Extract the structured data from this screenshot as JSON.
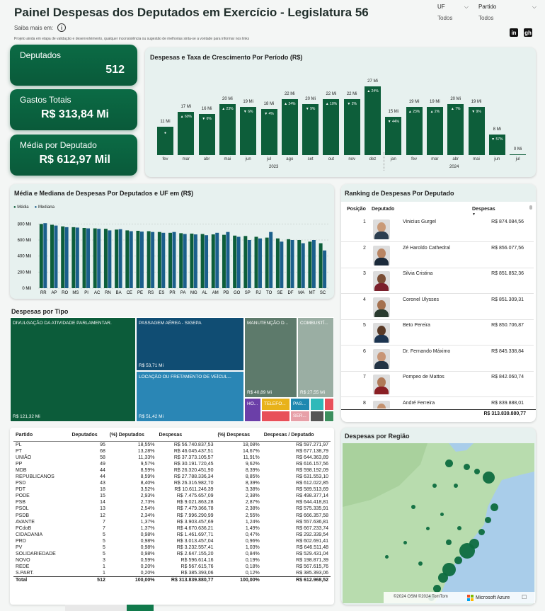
{
  "header": {
    "title": "Painel Despesas dos Deputados em Exercício - Legislatura 56",
    "saiba_mais": "Saiba mais em:",
    "info_icon": "i",
    "disclaimer": "Projeto ainda em etapa de validação e desenvolvimento, qualquer inconsistência ou sugestão de melhorias sinta-se a vontade para informar nos links",
    "filters": [
      {
        "label": "UF",
        "value": "Todos"
      },
      {
        "label": "Partido",
        "value": "Todos"
      }
    ],
    "social": [
      "in",
      "gh"
    ]
  },
  "kpis": [
    {
      "label": "Deputados",
      "value": "512"
    },
    {
      "label": "Gastos Totais",
      "value": "R$ 313,84 Mi"
    },
    {
      "label": "Média por Deputado",
      "value": "R$ 612,97 Mil"
    }
  ],
  "period_chart": {
    "title": "Despesas e Taxa de Crescimento Por Período (R$)",
    "bars": [
      {
        "month": "fev",
        "label": "11 Mi",
        "value": 11,
        "growth": ""
      },
      {
        "month": "mar",
        "label": "17 Mi",
        "value": 17,
        "growth": "▲ 60%"
      },
      {
        "month": "abr",
        "label": "16 Mi",
        "value": 16,
        "growth": "▼ 6%"
      },
      {
        "month": "mai",
        "label": "20 Mi",
        "value": 20,
        "growth": "▲ 23%"
      },
      {
        "month": "jun",
        "label": "19 Mi",
        "value": 19,
        "growth": "▼ 6%"
      },
      {
        "month": "jul",
        "label": "18 Mi",
        "value": 18,
        "growth": "▼ 4%"
      },
      {
        "month": "ago",
        "label": "22 Mi",
        "value": 22,
        "growth": "▲ 24%"
      },
      {
        "month": "set",
        "label": "20 Mi",
        "value": 20,
        "growth": "▼ 9%"
      },
      {
        "month": "out",
        "label": "22 Mi",
        "value": 22,
        "growth": "▲ 10%"
      },
      {
        "month": "nov",
        "label": "22 Mi",
        "value": 22,
        "growth": "▼ 2%"
      },
      {
        "month": "dez",
        "label": "27 Mi",
        "value": 27,
        "growth": "▲ 24%"
      },
      {
        "month": "jan",
        "label": "15 Mi",
        "value": 15,
        "growth": "▼ 44%"
      },
      {
        "month": "fev",
        "label": "19 Mi",
        "value": 19,
        "growth": "▲ 23%"
      },
      {
        "month": "mar",
        "label": "19 Mi",
        "value": 19,
        "growth": "▲ 2%"
      },
      {
        "month": "abr",
        "label": "20 Mi",
        "value": 20,
        "growth": "▲ 7%"
      },
      {
        "month": "mai",
        "label": "19 Mi",
        "value": 19,
        "growth": "▼ 9%"
      },
      {
        "month": "jun",
        "label": "8 Mi",
        "value": 8,
        "growth": "▼ 57%"
      },
      {
        "month": "jul",
        "label": "0 Mi",
        "value": 0.3,
        "growth": ""
      }
    ],
    "years": [
      "2023",
      "2024"
    ],
    "first_bar_marker": "●"
  },
  "chart_data": {
    "type": "bar",
    "title": "Média e Mediana de Despesas Por Deputados e UF em (R$)",
    "categories": [
      "RR",
      "AP",
      "RO",
      "MS",
      "PI",
      "AC",
      "RN",
      "BA",
      "CE",
      "PE",
      "RS",
      "ES",
      "PR",
      "PA",
      "MG",
      "AL",
      "AM",
      "PB",
      "GO",
      "SP",
      "RJ",
      "TO",
      "SE",
      "DF",
      "MA",
      "MT",
      "SC"
    ],
    "series": [
      {
        "name": "Média",
        "values": [
          800,
          790,
          770,
          760,
          750,
          745,
          740,
          730,
          720,
          715,
          710,
          700,
          690,
          685,
          680,
          675,
          670,
          665,
          655,
          650,
          640,
          630,
          620,
          610,
          600,
          580,
          560
        ]
      },
      {
        "name": "Mediana",
        "values": [
          810,
          780,
          760,
          755,
          745,
          740,
          720,
          735,
          710,
          705,
          700,
          690,
          700,
          675,
          670,
          660,
          690,
          700,
          640,
          600,
          620,
          700,
          580,
          600,
          560,
          600,
          470
        ]
      }
    ],
    "yticks": [
      "0 Mil",
      "200 Mil",
      "400 Mil",
      "600 Mil",
      "800 Mil"
    ],
    "ylim": [
      0,
      900
    ],
    "legend": "top-left"
  },
  "treemap": {
    "title": "Despesas por Tipo",
    "cells": [
      {
        "label": "DIVULGAÇÃO DA ATIVIDADE PARLAMENTAR.",
        "value": "R$ 121,32 Mi",
        "color": "#0c5c3a"
      },
      {
        "label": "PASSAGEM AÉREA - SIGEPA",
        "value": "R$ 53,71 Mi",
        "color": "#104d73"
      },
      {
        "label": "LOCAÇÃO OU FRETAMENTO DE VEÍCUL...",
        "value": "R$ 51,42 Mi",
        "color": "#2a86b5"
      },
      {
        "label": "MANUTENÇÃO D...",
        "value": "R$ 40,89 Mi",
        "color": "#5d7a6b"
      },
      {
        "label": "COMBUSTÍ...",
        "value": "R$ 27,55 Mi",
        "color": "#9aaea3"
      },
      {
        "label": "HO...",
        "value": "",
        "color": "#6b3fa8"
      },
      {
        "label": "TELEFO...",
        "value": "",
        "color": "#e8b21a"
      },
      {
        "label": "PAS...",
        "value": "",
        "color": "#1f88b0"
      },
      {
        "label": "",
        "value": "",
        "color": "#2fb9b9"
      },
      {
        "label": "",
        "value": "",
        "color": "#e8505a"
      },
      {
        "label": "SER...",
        "value": "",
        "color": "#e7a0a8"
      },
      {
        "label": "",
        "value": "",
        "color": "#555"
      },
      {
        "label": "",
        "value": "",
        "color": "#3c8f5e"
      }
    ]
  },
  "ranking": {
    "title": "Ranking de Despesas Por Deputado",
    "headers": [
      "Posição",
      "Deputado",
      "Despesas"
    ],
    "rows": [
      {
        "pos": "1",
        "name": "Vinicius Gurgel",
        "value": "R$ 874.084,56"
      },
      {
        "pos": "2",
        "name": "Zé Haroldo Cathedral",
        "value": "R$ 856.077,56"
      },
      {
        "pos": "3",
        "name": "Silvia Cristina",
        "value": "R$ 851.852,36"
      },
      {
        "pos": "4",
        "name": "Coronel Ulysses",
        "value": "R$ 851.309,31"
      },
      {
        "pos": "5",
        "name": "Beto Pereira",
        "value": "R$ 850.706,87"
      },
      {
        "pos": "6",
        "name": "Dr. Fernando Máximo",
        "value": "R$ 845.338,84"
      },
      {
        "pos": "7",
        "name": "Pompeo de Mattos",
        "value": "R$ 842.060,74"
      },
      {
        "pos": "8",
        "name": "André Ferreira",
        "value": "R$ 839.888,01"
      }
    ],
    "total": "R$ 313.839.880,77"
  },
  "party_table": {
    "headers": [
      "Partido",
      "Deputados",
      "(%) Deputados",
      "Despesas",
      "(%) Despesas",
      "Despesas / Deputado"
    ],
    "rows": [
      [
        "PL",
        "95",
        "18,55%",
        "R$ 56.740.837,53",
        "18,08%",
        "R$ 597.271,97"
      ],
      [
        "PT",
        "68",
        "13,28%",
        "R$ 46.045.437,51",
        "14,67%",
        "R$ 677.138,79"
      ],
      [
        "UNIÃO",
        "58",
        "11,33%",
        "R$ 37.373.105,57",
        "11,91%",
        "R$ 644.363,89"
      ],
      [
        "PP",
        "49",
        "9,57%",
        "R$ 30.191.720,45",
        "9,62%",
        "R$ 616.157,56"
      ],
      [
        "MDB",
        "44",
        "8,59%",
        "R$ 26.320.451,90",
        "8,39%",
        "R$ 598.192,09"
      ],
      [
        "REPUBLICANOS",
        "44",
        "8,59%",
        "R$ 27.788.336,34",
        "8,85%",
        "R$ 631.553,10"
      ],
      [
        "PSD",
        "43",
        "8,40%",
        "R$ 26.316.982,70",
        "8,39%",
        "R$ 612.022,85"
      ],
      [
        "PDT",
        "18",
        "3,52%",
        "R$ 10.611.246,39",
        "3,38%",
        "R$ 589.513,69"
      ],
      [
        "PODE",
        "15",
        "2,93%",
        "R$ 7.475.657,09",
        "2,38%",
        "R$ 498.377,14"
      ],
      [
        "PSB",
        "14",
        "2,73%",
        "R$ 9.021.863,28",
        "2,87%",
        "R$ 644.418,81"
      ],
      [
        "PSOL",
        "13",
        "2,54%",
        "R$ 7.479.366,78",
        "2,38%",
        "R$ 575.335,91"
      ],
      [
        "PSDB",
        "12",
        "2,34%",
        "R$ 7.996.290,99",
        "2,55%",
        "R$ 666.357,58"
      ],
      [
        "AVANTE",
        "7",
        "1,37%",
        "R$ 3.903.457,69",
        "1,24%",
        "R$ 557.636,81"
      ],
      [
        "PCdoB",
        "7",
        "1,37%",
        "R$ 4.670.636,21",
        "1,49%",
        "R$ 667.233,74"
      ],
      [
        "CIDADANIA",
        "5",
        "0,98%",
        "R$ 1.461.697,71",
        "0,47%",
        "R$ 292.339,54"
      ],
      [
        "PRD",
        "5",
        "0,98%",
        "R$ 3.013.457,04",
        "0,96%",
        "R$ 602.691,41"
      ],
      [
        "PV",
        "5",
        "0,98%",
        "R$ 3.232.557,41",
        "1,03%",
        "R$ 646.511,48"
      ],
      [
        "SOLIDARIEDADE",
        "5",
        "0,98%",
        "R$ 2.647.155,20",
        "0,84%",
        "R$ 529.431,04"
      ],
      [
        "NOVO",
        "3",
        "0,59%",
        "R$ 596.614,16",
        "0,19%",
        "R$ 198.871,39"
      ],
      [
        "REDE",
        "1",
        "0,20%",
        "R$ 567.615,76",
        "0,18%",
        "R$ 567.615,76"
      ],
      [
        "S.PART.",
        "1",
        "0,20%",
        "R$ 385.393,06",
        "0,12%",
        "R$ 385.393,06"
      ]
    ],
    "total": [
      "Total",
      "512",
      "100,00%",
      "R$ 313.839.880,77",
      "100,00%",
      "R$ 612.968,52"
    ]
  },
  "map": {
    "title": "Despesas por Região",
    "attribution": "©2024 OSM ©2024 TomTom",
    "brand": "Microsoft Azure",
    "feedback_icon": "☐"
  }
}
